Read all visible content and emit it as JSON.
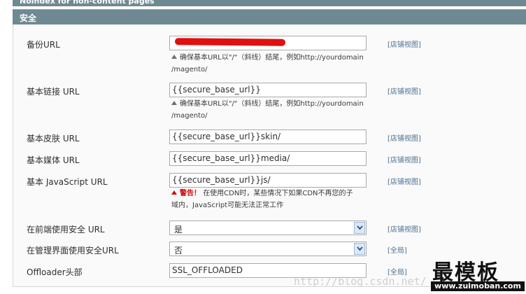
{
  "top_bar": {
    "title": "Noindex for non-content pages"
  },
  "section": {
    "title": "安全"
  },
  "fields": [
    {
      "label": "备份URL",
      "value": "",
      "scope": "[店铺视图]",
      "note": [
        "确保基本URL以\"/\"（斜线）结尾，例如http://yourdomain",
        "/magento/"
      ]
    },
    {
      "label": "基本链接 URL",
      "value": "{{secure_base_url}}",
      "scope": "[店铺视图]",
      "note": [
        "确保基本URL以\"/\"（斜线）结尾，例如http://yourdomain",
        "/magento/"
      ]
    },
    {
      "label": "基本皮肤 URL",
      "value": "{{secure_base_url}}skin/",
      "scope": "[店铺视图]"
    },
    {
      "label": "基本媒体 URL",
      "value": "{{secure_base_url}}media/",
      "scope": "[店铺视图]"
    },
    {
      "label": "基本 JavaScript URL",
      "value": "{{secure_base_url}}js/",
      "scope": "[店铺视图]",
      "warning_word": "警告！",
      "note": [
        "在使用CDN时，某些情况下如果CDN不再您的子",
        "域内，JavaScript可能无法正常工作"
      ]
    },
    {
      "label": "在前端使用安全 URL",
      "value": "是",
      "scope": "[店铺视图]"
    },
    {
      "label": "在管理界面使用安全URL",
      "value": "否",
      "scope": "[全局]"
    },
    {
      "label": "Offloader头部",
      "value": "SSL_OFFLOADED",
      "scope": "[全局]"
    }
  ],
  "watermark": {
    "text": "http://blog.csdn.net/"
  },
  "logo": {
    "main": "最模板",
    "sub": "www.zuimoban.com"
  },
  "colors": {
    "header_bg": "#6f8992",
    "scope_link": "#4b6f8f",
    "warning": "#d40707",
    "redaction": "#e01010"
  }
}
